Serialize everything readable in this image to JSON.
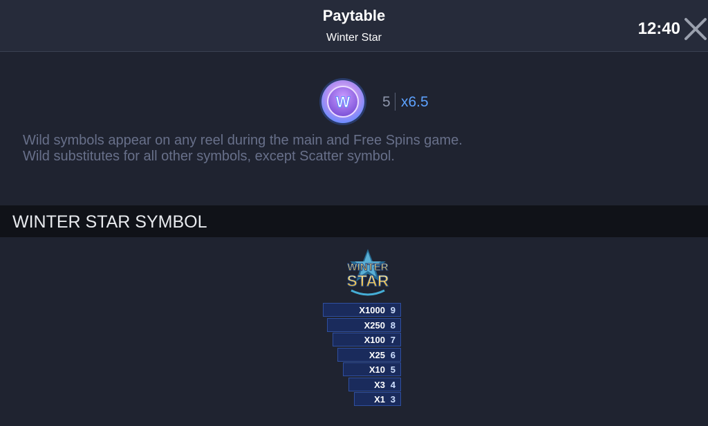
{
  "header": {
    "title": "Paytable",
    "subtitle": "Winter Star",
    "clock": "12:40",
    "close_icon": "close-icon"
  },
  "wild": {
    "symbol_icon": "wild-coin-icon",
    "symbol_letter": "W",
    "pay_count": "5",
    "pay_multiplier": "x6.5",
    "description_line1": "Wild symbols appear on any reel during the main and Free Spins game.",
    "description_line2": "Wild substitutes for all other symbols, except Scatter symbol."
  },
  "section": {
    "title": "WINTER STAR SYMBOL"
  },
  "winter_star": {
    "logo_icon": "winter-star-logo-icon",
    "logo_line1": "WINTER",
    "logo_line2": "STAR",
    "pays": [
      {
        "multiplier": "X1000",
        "count": "9"
      },
      {
        "multiplier": "X250",
        "count": "8"
      },
      {
        "multiplier": "X100",
        "count": "7"
      },
      {
        "multiplier": "X25",
        "count": "6"
      },
      {
        "multiplier": "X10",
        "count": "5"
      },
      {
        "multiplier": "X3",
        "count": "4"
      },
      {
        "multiplier": "X1",
        "count": "3"
      }
    ]
  },
  "colors": {
    "background": "#1f2330",
    "header": "#262b3a",
    "section_bar": "#101218",
    "accent_blue": "#5da2ff",
    "description_text": "#68708a",
    "pay_row_fill": "#1a2b5c",
    "pay_row_border": "#2f4fa0"
  }
}
